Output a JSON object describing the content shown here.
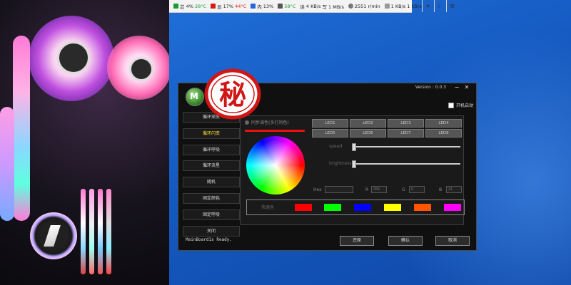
{
  "statusbar": {
    "items": [
      {
        "label": "芯",
        "value": "4%",
        "sub": "28°C",
        "color": "#1a9a35"
      },
      {
        "label": "显",
        "value": "17%",
        "sub": "44°C",
        "color": "#d21b1b"
      },
      {
        "label": "内",
        "value": "13%",
        "sub": "",
        "color": "#2566d8"
      },
      {
        "label": "",
        "value": "58°C",
        "sub": "",
        "color": "#1a9a35"
      },
      {
        "label": "读",
        "value": "4 KB/s",
        "sub": "写 1 MB/s",
        "color": "#333333"
      },
      {
        "label": "",
        "value": "2551",
        "sub": "r/min",
        "color": "#333333"
      },
      {
        "label": "",
        "value": "1 KB/s",
        "sub": "1 KB/s",
        "color": "#333333"
      }
    ]
  },
  "app": {
    "version": "Version : 0.0.3",
    "autostart_label": "开机启动",
    "seal_text": "秘",
    "modes": [
      {
        "label": "循环渐变",
        "active": false
      },
      {
        "label": "循环闪变",
        "active": true
      },
      {
        "label": "循环呼吸",
        "active": false
      },
      {
        "label": "循环流星",
        "active": false
      },
      {
        "label": "随机",
        "active": false
      },
      {
        "label": "固定颜色",
        "active": false
      },
      {
        "label": "固定呼吸",
        "active": false
      },
      {
        "label": "关闭",
        "active": false
      }
    ],
    "sync_label": "同步调色(多灯同色)",
    "leds": [
      "LED1",
      "LED2",
      "LED3",
      "LED4",
      "LED5",
      "LED6",
      "LED7",
      "LED8"
    ],
    "speed_label": "speed",
    "brightness_label": "brightness",
    "speed_value": 0,
    "brightness_value": 0,
    "hex_label": "Hex",
    "hex_value": "",
    "r_label": "R",
    "r_value": "255",
    "g_label": "G",
    "g_value": "0",
    "b_label": "B",
    "b_value": "21",
    "swatch_label": "快速色",
    "swatches": [
      "#ff0000",
      "#00ff00",
      "#0000ff",
      "#ffff00",
      "#ff5500",
      "#ff00ff"
    ],
    "status_text": "MainBoard1s Ready.",
    "buttons": {
      "restore": "还原",
      "confirm": "确认",
      "cancel": "取消"
    }
  }
}
